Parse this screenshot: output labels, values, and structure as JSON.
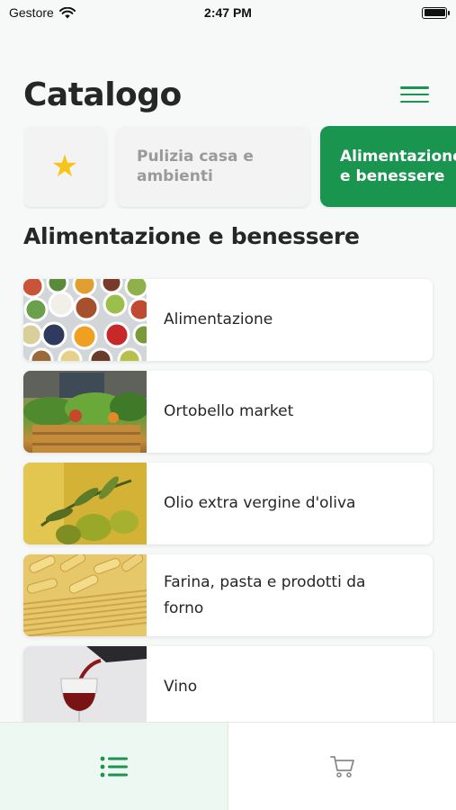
{
  "status_bar": {
    "carrier": "Gestore",
    "time": "2:47 PM"
  },
  "header": {
    "title": "Catalogo",
    "menu_icon": "hamburger-menu-icon"
  },
  "category_tabs": [
    {
      "id": "favorites",
      "icon": "star-icon",
      "label": "",
      "selected": false
    },
    {
      "id": "pulizia",
      "label_line1": "Pulizia casa e",
      "label_line2": "ambienti",
      "selected": false
    },
    {
      "id": "alimentazione",
      "label_line1": "Alimentazione",
      "label_line2": "e benessere",
      "selected": true
    }
  ],
  "section": {
    "title": "Alimentazione e benessere"
  },
  "items": [
    {
      "label": "Alimentazione",
      "image": "bowls-of-fruits-vegetables-image"
    },
    {
      "label": "Ortobello market",
      "image": "vegetable-crate-image"
    },
    {
      "label": "Olio extra vergine d'oliva",
      "image": "olive-oil-image"
    },
    {
      "label_line1": "Farina, pasta e prodotti da",
      "label_line2": "forno",
      "image": "pasta-image"
    },
    {
      "label": "Vino",
      "image": "wine-glass-image"
    }
  ],
  "bottom_nav": [
    {
      "id": "catalog",
      "icon": "list-icon",
      "selected": true
    },
    {
      "id": "cart",
      "icon": "cart-icon",
      "selected": false
    }
  ],
  "colors": {
    "accent": "#1a9550",
    "star": "#f5c518",
    "text": "#262626",
    "muted": "#9a9a9a"
  }
}
